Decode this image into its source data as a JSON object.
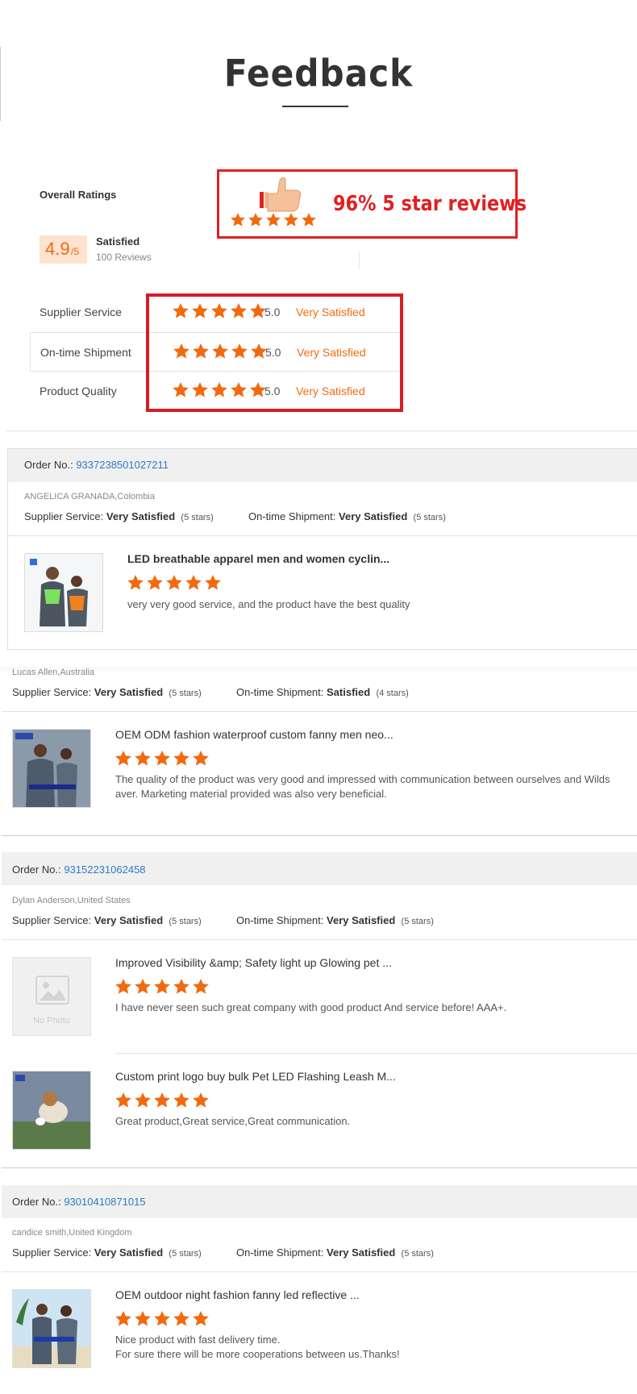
{
  "page_title": "Feedback",
  "overall": {
    "heading": "Overall Ratings",
    "score": "4.9",
    "score_suffix": "/5",
    "satisfaction": "Satisfied",
    "review_count": "100 Reviews"
  },
  "banner": {
    "text": "96% 5 star reviews"
  },
  "ratings": [
    {
      "label": "Supplier Service",
      "stars": 5,
      "value": "5.0",
      "verdict": "Very Satisfied"
    },
    {
      "label": "On-time Shipment",
      "stars": 5,
      "value": "5.0",
      "verdict": "Very Satisfied"
    },
    {
      "label": "Product Quality",
      "stars": 5,
      "value": "5.0",
      "verdict": "Very Satisfied"
    }
  ],
  "order_label": "Order No.:",
  "supplier_label": "Supplier Service:",
  "shipment_label": "On-time Shipment:",
  "orders": [
    {
      "order_no": "9337238501027211",
      "reviewer": "ANGELICA GRANADA,Colombia",
      "supplier_service": "Very Satisfied",
      "supplier_stars": "(5 stars)",
      "shipment": "Very Satisfied",
      "shipment_stars": "(5 stars)",
      "products": [
        {
          "title": "LED breathable apparel men and women cyclin...",
          "stars": 5,
          "comment": [
            "very very good service, and the product have the best quality"
          ]
        }
      ]
    },
    {
      "order_no": "",
      "reviewer": "Lucas Allen,Australia",
      "supplier_service": "Very Satisfied",
      "supplier_stars": "(5 stars)",
      "shipment": "Satisfied",
      "shipment_stars": "(4 stars)",
      "products": [
        {
          "title": "OEM ODM fashion waterproof custom fanny men neo...",
          "stars": 5,
          "comment": [
            "The quality of the product was very good and impressed with communication between ourselves and Wilds",
            "aver. Marketing material provided was also very beneficial."
          ]
        }
      ]
    },
    {
      "order_no": "93152231062458",
      "reviewer": "Dylan Anderson,United States",
      "supplier_service": "Very Satisfied",
      "supplier_stars": "(5 stars)",
      "shipment": "Very Satisfied",
      "shipment_stars": "(5 stars)",
      "products": [
        {
          "title": "Improved Visibility &amp; Safety light up Glowing pet ...",
          "stars": 5,
          "comment": [
            "I have never seen such great company with good product And service before!  AAA+."
          ],
          "no_photo": "No Photo"
        },
        {
          "title": "Custom print logo buy bulk Pet LED Flashing Leash M...",
          "stars": 5,
          "comment": [
            "Great product,Great service,Great communication."
          ]
        }
      ]
    },
    {
      "order_no": "93010410871015",
      "reviewer": "candice smith,United Kingdom",
      "supplier_service": "Very Satisfied",
      "supplier_stars": "(5 stars)",
      "shipment": "Very Satisfied",
      "shipment_stars": "(5 stars)",
      "products": [
        {
          "title": "OEM outdoor night fashion fanny led reflective ...",
          "stars": 5,
          "comment": [
            "Nice product with fast delivery time.",
            "For sure there will be more cooperations between us.Thanks!"
          ]
        }
      ]
    }
  ],
  "colors": {
    "accent": "#f26a10",
    "highlight_red": "#e02020",
    "link": "#2e7bc6"
  }
}
